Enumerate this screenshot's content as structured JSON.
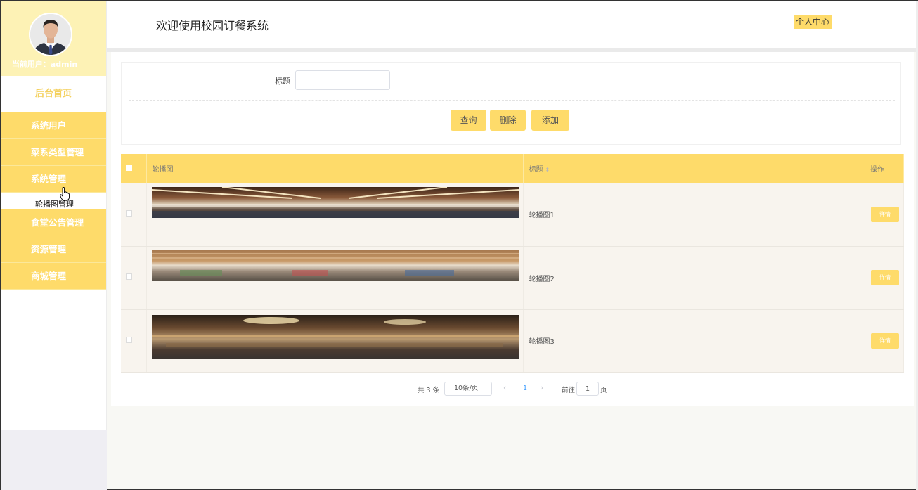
{
  "sidebar": {
    "user_label": "当前用户：admin",
    "home": "后台首页",
    "menu": [
      {
        "label": "系统用户"
      },
      {
        "label": "菜系类型管理"
      },
      {
        "label": "系统管理"
      },
      {
        "label": "食堂公告管理"
      },
      {
        "label": "资源管理"
      },
      {
        "label": "商城管理"
      }
    ],
    "submenu_label": "轮播图管理"
  },
  "header": {
    "title": "欢迎使用校园订餐系统",
    "profile": "个人中心"
  },
  "search": {
    "label": "标题",
    "value": "",
    "buttons": {
      "query": "查询",
      "delete": "删除",
      "add": "添加"
    }
  },
  "table": {
    "columns": {
      "image": "轮播图",
      "title": "标题",
      "actions": "操作"
    },
    "rows": [
      {
        "title": "轮播图1",
        "action": "详情"
      },
      {
        "title": "轮播图2",
        "action": "详情"
      },
      {
        "title": "轮播图3",
        "action": "详情"
      }
    ]
  },
  "pagination": {
    "total": "共 3 条",
    "page_size": "10条/页",
    "current_page": "1",
    "goto_prefix": "前往",
    "goto_value": "1",
    "goto_suffix": "页",
    "prev_icon": "chevron-left-icon",
    "next_icon": "chevron-right-icon"
  },
  "colors": {
    "accent": "#fedb6a",
    "header_bg": "#fdf2b5",
    "home_text": "#f4d160",
    "row_bg": "#f8f4ee"
  }
}
